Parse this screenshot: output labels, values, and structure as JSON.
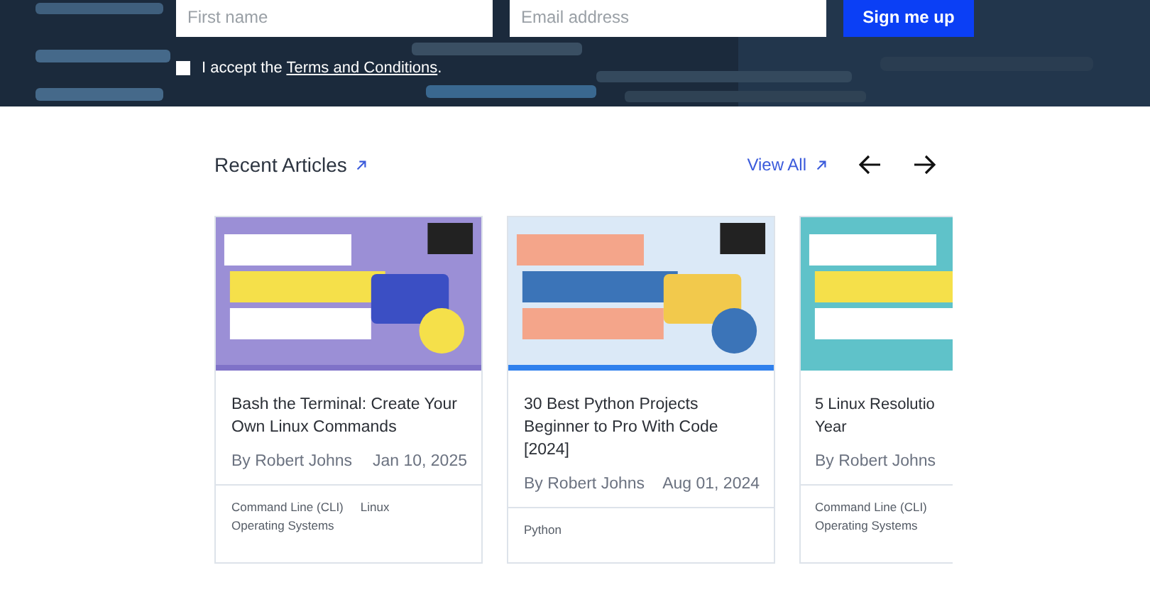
{
  "signup": {
    "first_name": {
      "placeholder": "First name"
    },
    "email": {
      "placeholder": "Email address"
    },
    "submit": "Sign me up",
    "consent": {
      "checked": false,
      "before": "I accept the ",
      "link": "Terms and Conditions",
      "after": "."
    }
  },
  "section": {
    "title": "Recent Articles",
    "view_all": "View All"
  },
  "articles": [
    {
      "title": "Bash the Terminal: Create Your Own Linux Commands",
      "author": "By Robert Johns",
      "date": "Jan 10, 2025",
      "tags": [
        "Command Line (CLI)",
        "Linux",
        "Operating Systems"
      ],
      "image": {
        "kind": "picture"
      }
    },
    {
      "title": "30 Best Python Projects Beginner to Pro With Code [2024]",
      "author": "By Robert Johns",
      "date": "Aug 01, 2024",
      "tags": [
        "Python"
      ],
      "image": {
        "kind": "picture"
      }
    },
    {
      "title": "5 Linux Resolutio\nYear",
      "author": "By Robert Johns",
      "tags": [
        "Command Line (CLI)",
        "Operating Systems"
      ],
      "image": {
        "kind": "picture"
      }
    }
  ]
}
